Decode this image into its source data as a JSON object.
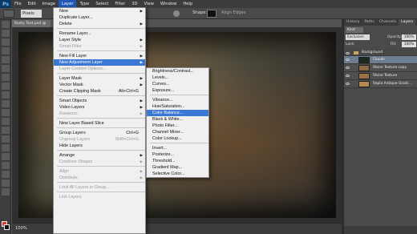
{
  "app": {
    "logo": "Ps"
  },
  "menubar": [
    {
      "label": "File"
    },
    {
      "label": "Edit"
    },
    {
      "label": "Image"
    },
    {
      "label": "Layer",
      "active": true
    },
    {
      "label": "Type"
    },
    {
      "label": "Select"
    },
    {
      "label": "Filter"
    },
    {
      "label": "3D"
    },
    {
      "label": "View"
    },
    {
      "label": "Window"
    },
    {
      "label": "Help"
    }
  ],
  "options": {
    "units": "Pixels",
    "shape_label": "Shape:",
    "align_edges": "Align Edges"
  },
  "document": {
    "tab_title": "Rusty Text.psd @ 100%",
    "zoom": "100%"
  },
  "layer_menu": [
    {
      "label": "New",
      "submenu": true
    },
    {
      "label": "Duplicate Layer..."
    },
    {
      "label": "Delete",
      "submenu": true
    },
    {
      "sep": true
    },
    {
      "label": "Rename Layer..."
    },
    {
      "label": "Layer Style",
      "submenu": true
    },
    {
      "label": "Smart Filter",
      "submenu": true,
      "disabled": true
    },
    {
      "sep": true
    },
    {
      "label": "New Fill Layer",
      "submenu": true
    },
    {
      "label": "New Adjustment Layer",
      "submenu": true,
      "highlight": true
    },
    {
      "label": "Layer Content Options...",
      "disabled": true
    },
    {
      "sep": true
    },
    {
      "label": "Layer Mask",
      "submenu": true
    },
    {
      "label": "Vector Mask",
      "submenu": true
    },
    {
      "label": "Create Clipping Mask",
      "shortcut": "Alt+Ctrl+G"
    },
    {
      "sep": true
    },
    {
      "label": "Smart Objects",
      "submenu": true
    },
    {
      "label": "Video Layers",
      "submenu": true
    },
    {
      "label": "Rasterize",
      "submenu": true,
      "disabled": true
    },
    {
      "sep": true
    },
    {
      "label": "New Layer Based Slice"
    },
    {
      "sep": true
    },
    {
      "label": "Group Layers",
      "shortcut": "Ctrl+G"
    },
    {
      "label": "Ungroup Layers",
      "shortcut": "Shift+Ctrl+G",
      "disabled": true
    },
    {
      "label": "Hide Layers"
    },
    {
      "sep": true
    },
    {
      "label": "Arrange",
      "submenu": true
    },
    {
      "label": "Combine Shapes",
      "submenu": true,
      "disabled": true
    },
    {
      "sep": true
    },
    {
      "label": "Align",
      "submenu": true,
      "disabled": true
    },
    {
      "label": "Distribute",
      "submenu": true,
      "disabled": true
    },
    {
      "sep": true
    },
    {
      "label": "Lock All Layers in Group...",
      "disabled": true
    },
    {
      "sep": true
    },
    {
      "label": "Link Layers",
      "disabled": true
    }
  ],
  "adjustment_menu": [
    {
      "label": "Brightness/Contrast..."
    },
    {
      "label": "Levels..."
    },
    {
      "label": "Curves..."
    },
    {
      "label": "Exposure..."
    },
    {
      "sep": true
    },
    {
      "label": "Vibrance..."
    },
    {
      "label": "Hue/Saturation..."
    },
    {
      "label": "Color Balance...",
      "highlight": true
    },
    {
      "label": "Black & White..."
    },
    {
      "label": "Photo Filter..."
    },
    {
      "label": "Channel Mixer..."
    },
    {
      "label": "Color Lookup..."
    },
    {
      "sep": true
    },
    {
      "label": "Invert..."
    },
    {
      "label": "Posterize..."
    },
    {
      "label": "Threshold..."
    },
    {
      "label": "Gradient Map..."
    },
    {
      "label": "Selective Color..."
    }
  ],
  "panel": {
    "tabs": [
      {
        "label": "History"
      },
      {
        "label": "Paths"
      },
      {
        "label": "Channels"
      },
      {
        "label": "Layers",
        "active": true
      }
    ],
    "kind": "Kind",
    "blend_mode": "Exclusion",
    "opacity_label": "Opacity:",
    "opacity": "100%",
    "lock_label": "Lock:",
    "fill_label": "Fill:",
    "fill": "100%",
    "layers": [
      {
        "name": "Background",
        "group": true
      },
      {
        "name": "Clouds",
        "selected": true,
        "thumb": "#1c2a22"
      },
      {
        "name": "Stone Texture copy",
        "thumb": "#8a6a44"
      },
      {
        "name": "Stone Texture",
        "thumb": "#9a7246"
      },
      {
        "name": "Sepia Antique Gradi...",
        "thumb": "#b58a52"
      }
    ]
  }
}
